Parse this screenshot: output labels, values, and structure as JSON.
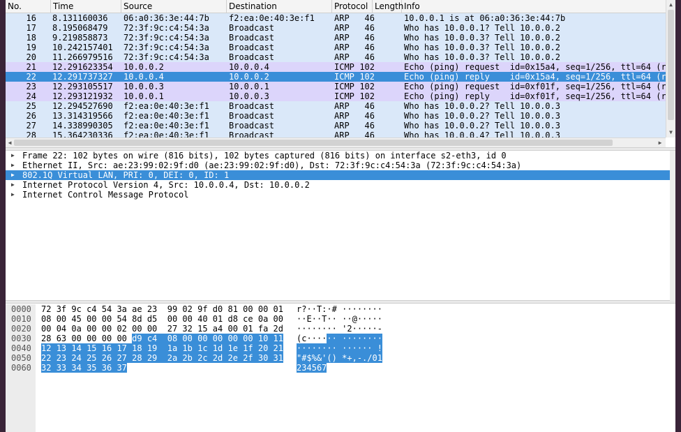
{
  "packet_list": {
    "columns": [
      "No.",
      "Time",
      "Source",
      "Destination",
      "Protocol",
      "Length",
      "Info"
    ],
    "rows": [
      {
        "no": "16",
        "time": "8.131160036",
        "src": "06:a0:36:3e:44:7b",
        "dst": "f2:ea:0e:40:3e:f1",
        "proto": "ARP",
        "len": "46",
        "info": "10.0.0.1 is at 06:a0:36:3e:44:7b"
      },
      {
        "no": "17",
        "time": "8.195068479",
        "src": "72:3f:9c:c4:54:3a",
        "dst": "Broadcast",
        "proto": "ARP",
        "len": "46",
        "info": "Who has 10.0.0.1? Tell 10.0.0.2"
      },
      {
        "no": "18",
        "time": "9.219858873",
        "src": "72:3f:9c:c4:54:3a",
        "dst": "Broadcast",
        "proto": "ARP",
        "len": "46",
        "info": "Who has 10.0.0.3? Tell 10.0.0.2"
      },
      {
        "no": "19",
        "time": "10.242157401",
        "src": "72:3f:9c:c4:54:3a",
        "dst": "Broadcast",
        "proto": "ARP",
        "len": "46",
        "info": "Who has 10.0.0.3? Tell 10.0.0.2"
      },
      {
        "no": "20",
        "time": "11.266979516",
        "src": "72:3f:9c:c4:54:3a",
        "dst": "Broadcast",
        "proto": "ARP",
        "len": "46",
        "info": "Who has 10.0.0.3? Tell 10.0.0.2"
      },
      {
        "no": "21",
        "time": "12.291623354",
        "src": "10.0.0.2",
        "dst": "10.0.0.4",
        "proto": "ICMP",
        "len": "102",
        "info": "Echo (ping) request  id=0x15a4, seq=1/256, ttl=64 (r"
      },
      {
        "no": "22",
        "time": "12.291737327",
        "src": "10.0.0.4",
        "dst": "10.0.0.2",
        "proto": "ICMP",
        "len": "102",
        "info": "Echo (ping) reply    id=0x15a4, seq=1/256, ttl=64 (r"
      },
      {
        "no": "23",
        "time": "12.293105517",
        "src": "10.0.0.3",
        "dst": "10.0.0.1",
        "proto": "ICMP",
        "len": "102",
        "info": "Echo (ping) request  id=0xf01f, seq=1/256, ttl=64 (r"
      },
      {
        "no": "24",
        "time": "12.293121932",
        "src": "10.0.0.1",
        "dst": "10.0.0.3",
        "proto": "ICMP",
        "len": "102",
        "info": "Echo (ping) reply    id=0xf01f, seq=1/256, ttl=64 (r"
      },
      {
        "no": "25",
        "time": "12.294527690",
        "src": "f2:ea:0e:40:3e:f1",
        "dst": "Broadcast",
        "proto": "ARP",
        "len": "46",
        "info": "Who has 10.0.0.2? Tell 10.0.0.3"
      },
      {
        "no": "26",
        "time": "13.314319566",
        "src": "f2:ea:0e:40:3e:f1",
        "dst": "Broadcast",
        "proto": "ARP",
        "len": "46",
        "info": "Who has 10.0.0.2? Tell 10.0.0.3"
      },
      {
        "no": "27",
        "time": "14.338990305",
        "src": "f2:ea:0e:40:3e:f1",
        "dst": "Broadcast",
        "proto": "ARP",
        "len": "46",
        "info": "Who has 10.0.0.2? Tell 10.0.0.3"
      },
      {
        "no": "28",
        "time": "15.364230336",
        "src": "f2:ea:0e:40:3e:f1",
        "dst": "Broadcast",
        "proto": "ARP",
        "len": "46",
        "info": "Who has 10.0.0.4? Tell 10.0.0.3"
      }
    ],
    "selected_no": "22"
  },
  "details": {
    "rows": [
      {
        "text": "Frame 22: 102 bytes on wire (816 bits), 102 bytes captured (816 bits) on interface s2-eth3, id 0",
        "selected": false
      },
      {
        "text": "Ethernet II, Src: ae:23:99:02:9f:d0 (ae:23:99:02:9f:d0), Dst: 72:3f:9c:c4:54:3a (72:3f:9c:c4:54:3a)",
        "selected": false
      },
      {
        "text": "802.1Q Virtual LAN, PRI: 0, DEI: 0, ID: 1",
        "selected": true
      },
      {
        "text": "Internet Protocol Version 4, Src: 10.0.0.4, Dst: 10.0.0.2",
        "selected": false
      },
      {
        "text": "Internet Control Message Protocol",
        "selected": false
      }
    ]
  },
  "bytes": {
    "rows": [
      {
        "offset": "0000",
        "hex": [
          "72",
          "3f",
          "9c",
          "c4",
          "54",
          "3a",
          "ae",
          "23",
          "99",
          "02",
          "9f",
          "d0",
          "81",
          "00",
          "00",
          "01"
        ],
        "ascii": "r?··T:·# ········"
      },
      {
        "offset": "0010",
        "hex": [
          "08",
          "00",
          "45",
          "00",
          "00",
          "54",
          "8d",
          "d5",
          "00",
          "00",
          "40",
          "01",
          "d8",
          "ce",
          "0a",
          "00"
        ],
        "ascii": "··E··T·· ··@·····"
      },
      {
        "offset": "0020",
        "hex": [
          "00",
          "04",
          "0a",
          "00",
          "00",
          "02",
          "00",
          "00",
          "27",
          "32",
          "15",
          "a4",
          "00",
          "01",
          "fa",
          "2d"
        ],
        "ascii": "········ '2·····-"
      },
      {
        "offset": "0030",
        "hex": [
          "28",
          "63",
          "00",
          "00",
          "00",
          "00",
          "d9",
          "c4",
          "08",
          "00",
          "00",
          "00",
          "00",
          "00",
          "10",
          "11"
        ],
        "ascii": "(c······ ········"
      },
      {
        "offset": "0040",
        "hex": [
          "12",
          "13",
          "14",
          "15",
          "16",
          "17",
          "18",
          "19",
          "1a",
          "1b",
          "1c",
          "1d",
          "1e",
          "1f",
          "20",
          "21"
        ],
        "ascii": "········ ······ !"
      },
      {
        "offset": "0050",
        "hex": [
          "22",
          "23",
          "24",
          "25",
          "26",
          "27",
          "28",
          "29",
          "2a",
          "2b",
          "2c",
          "2d",
          "2e",
          "2f",
          "30",
          "31"
        ],
        "ascii": "\"#$%&'() *+,-./01"
      },
      {
        "offset": "0060",
        "hex": [
          "32",
          "33",
          "34",
          "35",
          "36",
          "37"
        ],
        "ascii": "234567"
      }
    ],
    "highlight_start": 54
  },
  "colors": {
    "arp_row": "#dae8f9",
    "icmp_row": "#dcd5fb",
    "selected": "#3a8ed8"
  }
}
